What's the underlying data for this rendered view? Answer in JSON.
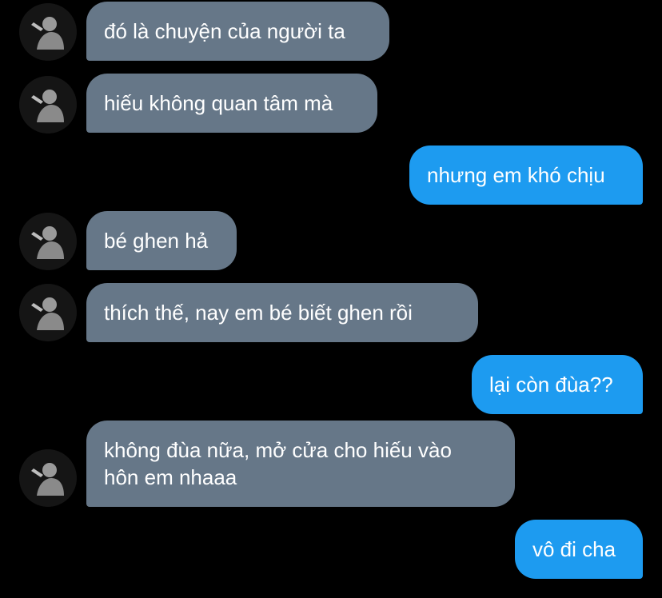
{
  "conversation": {
    "messages": [
      {
        "sender": "other",
        "text": "đó là chuyện của người ta"
      },
      {
        "sender": "other",
        "text": "hiếu không quan tâm mà"
      },
      {
        "sender": "me",
        "text": "nhưng em khó chịu"
      },
      {
        "sender": "other",
        "text": "bé ghen hả"
      },
      {
        "sender": "other",
        "text": "thích thế, nay em bé biết ghen rồi"
      },
      {
        "sender": "me",
        "text": "lại còn đùa??"
      },
      {
        "sender": "other",
        "lines": [
          "không đùa nữa, mở cửa cho hiếu vào",
          "hôn em nhaaa"
        ]
      },
      {
        "sender": "me",
        "text": "vô đi cha"
      }
    ]
  },
  "colors": {
    "background": "#000000",
    "incoming_bubble": "#667788",
    "outgoing_bubble": "#1d9bf0",
    "text": "#ffffff"
  },
  "icons": {
    "avatar": "profile-photo-avatar"
  }
}
